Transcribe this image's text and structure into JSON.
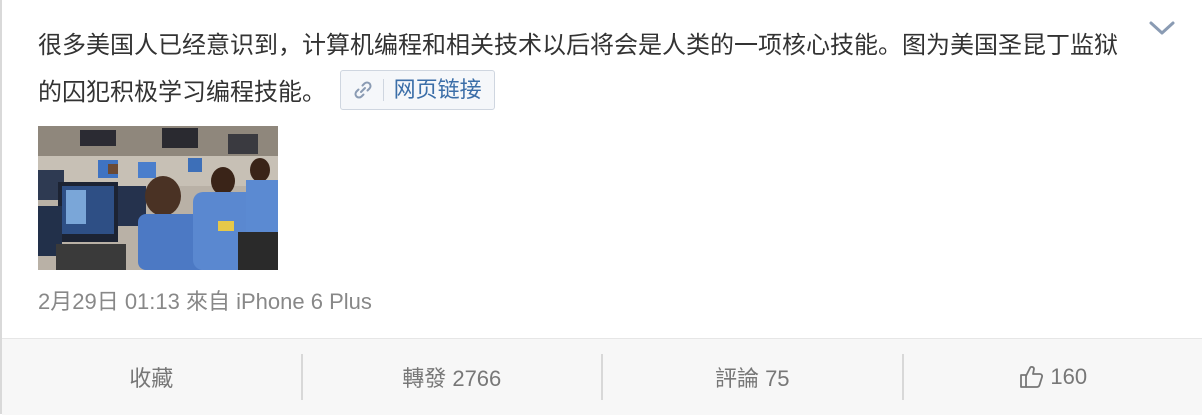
{
  "post": {
    "text": "很多美国人已经意识到，计算机编程和相关技术以后将会是人类的一项核心技能。图为美国圣昆丁监狱的囚犯积极学习编程技能。",
    "link_label": "网页链接",
    "link_icon": "link-icon",
    "timestamp": "2月29日 01:13",
    "source": "來自 iPhone 6 Plus"
  },
  "actions": {
    "favorite": "收藏",
    "repost": "轉發 2766",
    "comment": "評論 75",
    "like_count": "160",
    "like_icon": "thumbs-up-icon"
  },
  "colors": {
    "text": "#333333",
    "link": "#3b6ea8",
    "meta": "#888888",
    "action_bar": "#f7f7f7"
  }
}
